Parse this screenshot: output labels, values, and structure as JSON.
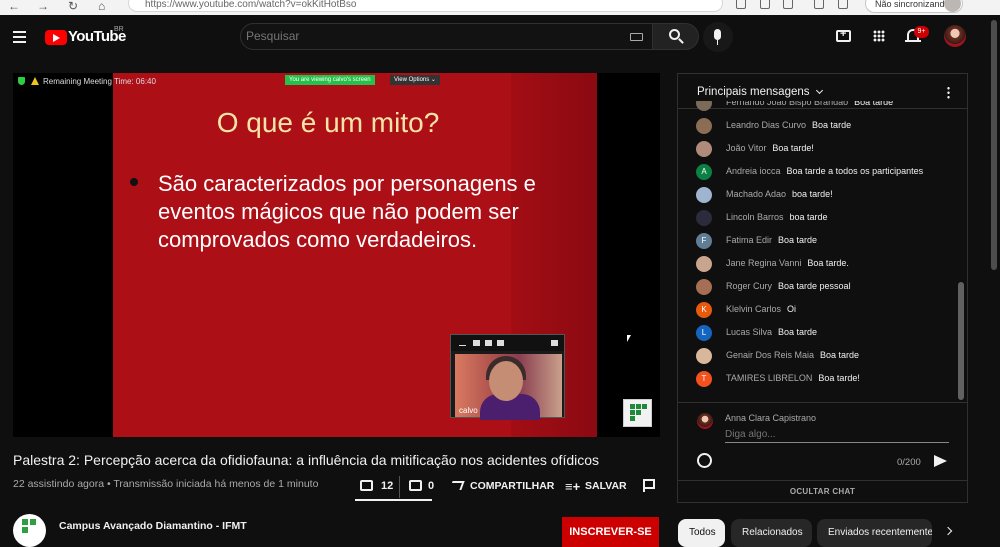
{
  "browser": {
    "url": "https://www.youtube.com/watch?v=okKitHotBso",
    "sync_label": "Não sincronizando"
  },
  "header": {
    "logo_text": "YouTube",
    "region": "BR",
    "search_placeholder": "Pesquisar",
    "notification_count": "9+"
  },
  "video": {
    "meeting_time": "Remaining Meeting Time: 06:40",
    "viewing_badge": "You are viewing calvo's screen",
    "view_options": "View Options ⌄",
    "slide_heading": "O que é um mito?",
    "slide_bullet": "São caracterizados por personagens e eventos mágicos que não podem ser comprovados como verdadeiros.",
    "participant_name": "calvo"
  },
  "info": {
    "title": "Palestra 2: Percepção acerca da ofidiofauna: a influência da mitificação nos acidentes ofídicos",
    "meta": "22 assistindo agora • Transmissão iniciada há menos de 1 minuto",
    "like_count": "12",
    "dislike_count": "0",
    "share_label": "COMPARTILHAR",
    "save_label": "SALVAR",
    "channel_name": "Campus Avançado Diamantino - IFMT",
    "subscribe_label": "INSCREVER-SE"
  },
  "chat": {
    "title": "Principais mensagens",
    "messages": [
      {
        "author": "Fernando João Bispo Brandão",
        "text": "Boa tarde",
        "avatar": "photo",
        "color": "#7a6a5a"
      },
      {
        "author": "Leandro Dias Curvo",
        "text": "Boa tarde",
        "avatar": "photo",
        "color": "#8a6d52"
      },
      {
        "author": "João Vitor",
        "text": "Boa tarde!",
        "avatar": "photo",
        "color": "#b08a7a"
      },
      {
        "author": "Andreia iocca",
        "text": "Boa tarde a todos os participantes",
        "avatar": "A",
        "color": "#0b8043"
      },
      {
        "author": "Machado Adao",
        "text": "boa tarde!",
        "avatar": "photo",
        "color": "#9fb5cf"
      },
      {
        "author": "Lincoln Barros",
        "text": "boa tarde",
        "avatar": "photo",
        "color": "#2b2b3b"
      },
      {
        "author": "Fatima Edir",
        "text": "Boa tarde",
        "avatar": "F",
        "color": "#5f7d95"
      },
      {
        "author": "Jane Regina Vanni",
        "text": "Boa tarde.",
        "avatar": "photo",
        "color": "#c9a58f"
      },
      {
        "author": "Roger Cury",
        "text": "Boa tarde pessoal",
        "avatar": "photo",
        "color": "#a46f55"
      },
      {
        "author": "Klelvin Carlos",
        "text": "Oi",
        "avatar": "K",
        "color": "#e8590c"
      },
      {
        "author": "Lucas Silva",
        "text": "Boa tarde",
        "avatar": "L",
        "color": "#1565c0"
      },
      {
        "author": "Genair Dos Reis Maia",
        "text": "Boa tarde",
        "avatar": "photo",
        "color": "#d9b79a"
      },
      {
        "author": "TAMIRES LIBRELON",
        "text": "Boa tarde!",
        "avatar": "T",
        "color": "#f4511e"
      }
    ],
    "input_username": "Anna Clara Capistrano",
    "input_placeholder": "Diga algo...",
    "char_counter": "0/200",
    "hide_chat_label": "OCULTAR CHAT"
  },
  "chips": [
    {
      "label": "Todos",
      "active": true
    },
    {
      "label": "Relacionados",
      "active": false
    },
    {
      "label": "Enviados recentemente",
      "active": false
    }
  ],
  "colors": {
    "accent": "#ff0000",
    "subscribe": "#cc0000",
    "background": "#0f0f0f",
    "slide": "#ad0f17"
  }
}
